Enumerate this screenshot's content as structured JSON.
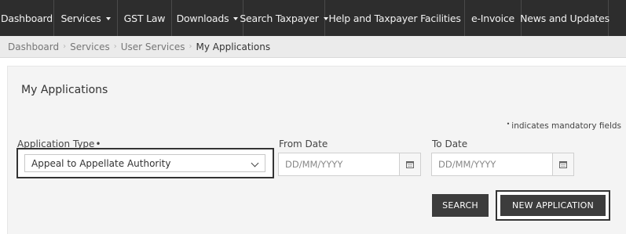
{
  "nav": {
    "dashboard": "Dashboard",
    "services": "Services",
    "gst_law": "GST Law",
    "downloads": "Downloads",
    "search_taxpayer": "Search Taxpayer",
    "help": "Help and Taxpayer Facilities",
    "einvoice": "e-Invoice",
    "news": "News and Updates"
  },
  "breadcrumb": {
    "items": [
      "Dashboard",
      "Services",
      "User Services"
    ],
    "current": "My Applications"
  },
  "page": {
    "title": "My Applications",
    "mandatory_note": "indicates mandatory fields",
    "mandatory_marker": "•"
  },
  "form": {
    "application_type_label": "Application Type",
    "required_marker": "•",
    "application_type_value": "Appeal to Appellate Authority",
    "from_date_label": "From Date",
    "from_date_placeholder": "DD/MM/YYYY",
    "to_date_label": "To Date",
    "to_date_placeholder": "DD/MM/YYYY"
  },
  "actions": {
    "search": "SEARCH",
    "new_application": "NEW APPLICATION"
  },
  "icons": {
    "dropdown": "chevron-down-icon",
    "calendar": "calendar-icon",
    "caret": "caret-down-icon"
  },
  "colors": {
    "nav_bg": "#2d2d2d",
    "button_bg": "#3c3c3c",
    "panel_bg": "#f4f4f4"
  }
}
